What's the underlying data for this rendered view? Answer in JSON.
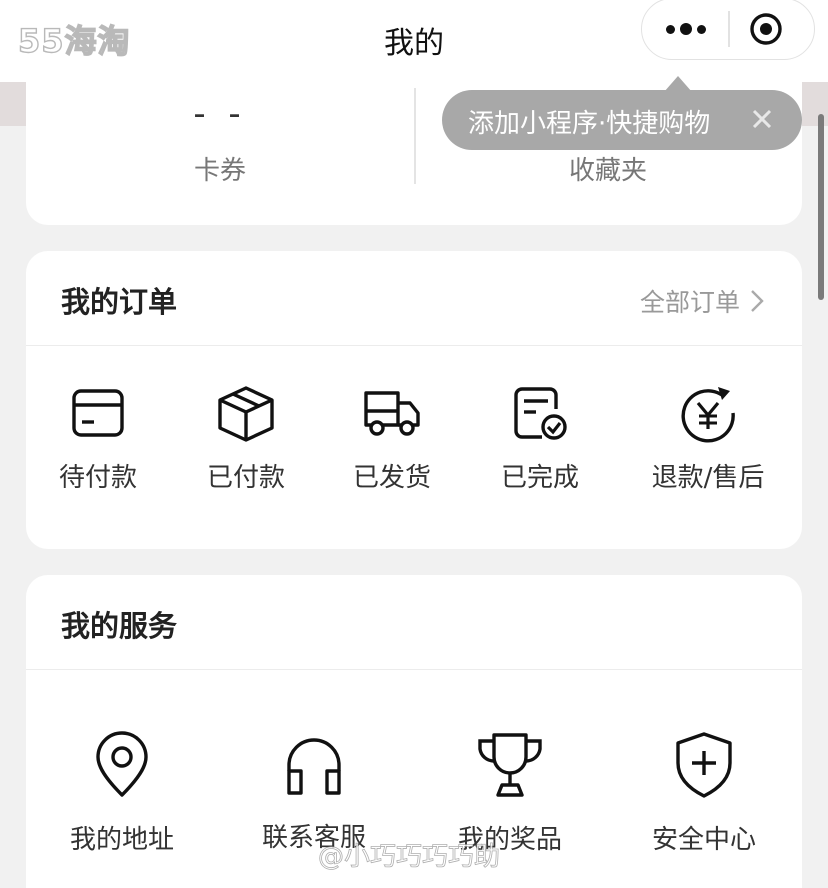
{
  "navbar": {
    "title": "我的",
    "logo_text": "55海淘"
  },
  "capsule": {
    "more_icon": "more-dots-icon",
    "close_icon": "target-circle-icon"
  },
  "stats": [
    {
      "value": "- -",
      "label": "卡券"
    },
    {
      "value": "",
      "label": "收藏夹"
    }
  ],
  "toast": {
    "text": "添加小程序·快捷购物",
    "close_icon": "close-x-icon"
  },
  "orders": {
    "title": "我的订单",
    "all_link": "全部订单",
    "items": [
      {
        "label": "待付款",
        "icon": "card-icon"
      },
      {
        "label": "已付款",
        "icon": "package-box-icon"
      },
      {
        "label": "已发货",
        "icon": "delivery-truck-icon"
      },
      {
        "label": "已完成",
        "icon": "document-check-icon"
      },
      {
        "label": "退款/售后",
        "icon": "yen-refund-icon"
      }
    ]
  },
  "services": {
    "title": "我的服务",
    "items": [
      {
        "label": "我的地址",
        "icon": "location-pin-icon"
      },
      {
        "label": "联系客服",
        "icon": "headphones-icon"
      },
      {
        "label": "我的奖品",
        "icon": "trophy-icon"
      },
      {
        "label": "安全中心",
        "icon": "shield-plus-icon"
      }
    ]
  },
  "watermark": {
    "text": "@小巧巧巧巧助"
  }
}
